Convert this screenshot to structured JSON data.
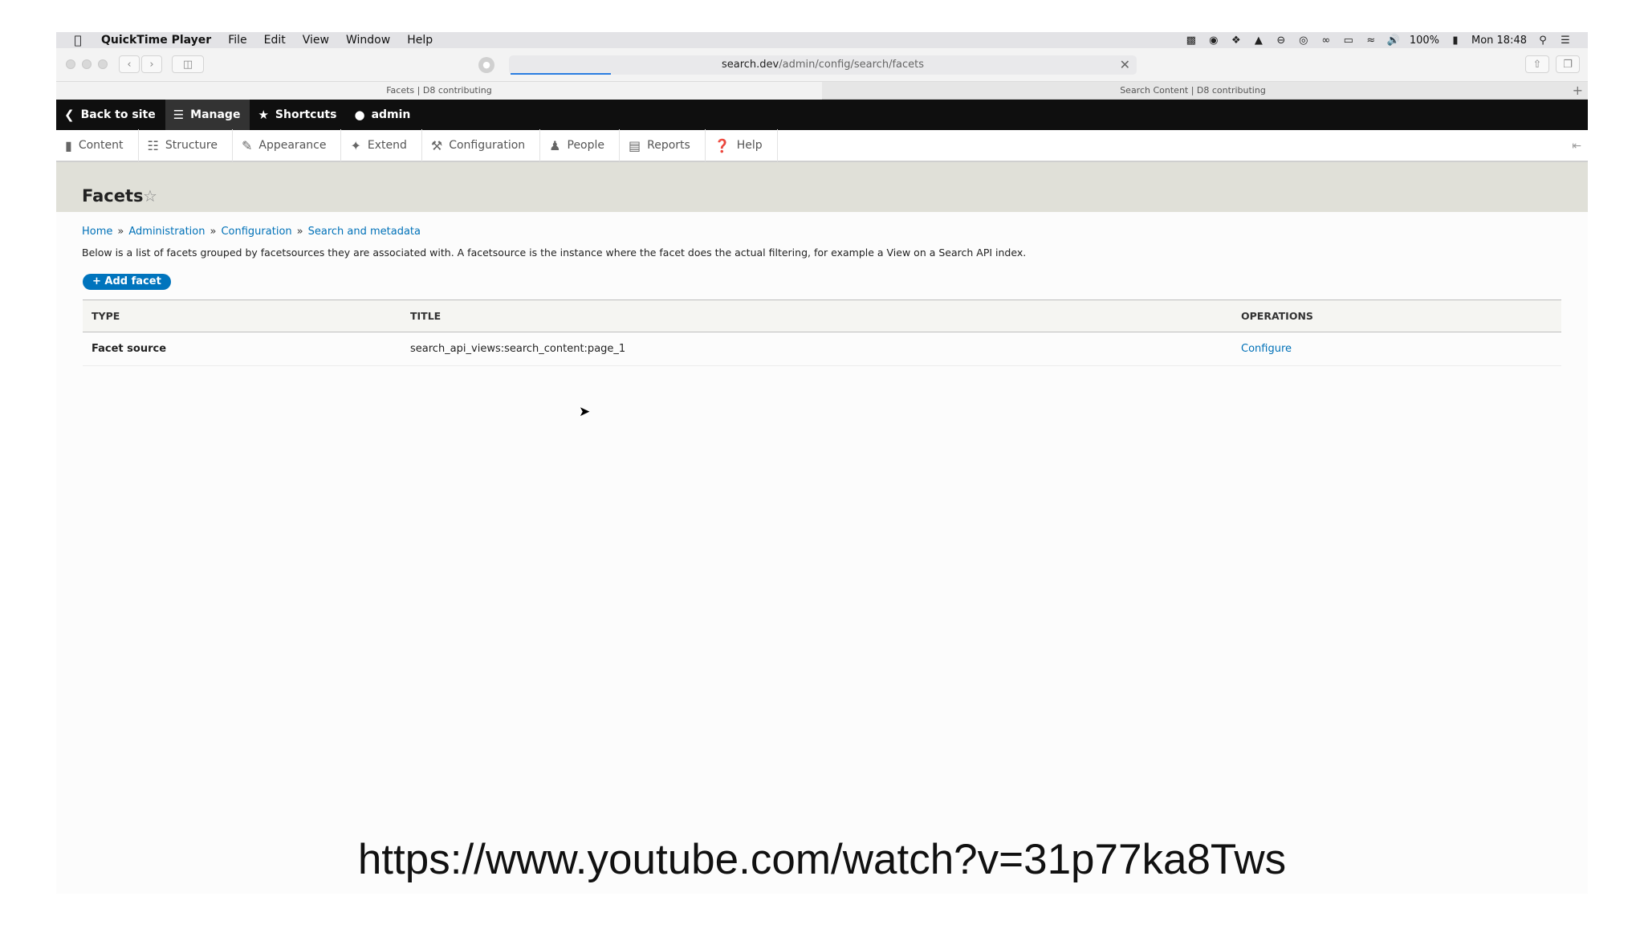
{
  "menubar": {
    "apple_icon": "apple-logo-icon",
    "app_name": "QuickTime Player",
    "menus": [
      "File",
      "Edit",
      "View",
      "Window",
      "Help"
    ],
    "status_icons": [
      "notification-icon",
      "record-icon",
      "dropbox-icon",
      "drive-icon",
      "focus-icon",
      "timer-icon",
      "glasses-icon",
      "airplay-icon",
      "wifi-icon",
      "volume-icon"
    ],
    "battery": "100%",
    "clock": "Mon 18:48"
  },
  "browser": {
    "url_host": "search.dev",
    "url_path": "/admin/config/search/facets",
    "tabs": [
      "Facets | D8 contributing",
      "Search Content | D8 contributing"
    ]
  },
  "drupal_toolbar": {
    "items": [
      {
        "label": "Back to site",
        "icon": "back-icon"
      },
      {
        "label": "Manage",
        "icon": "menu-icon"
      },
      {
        "label": "Shortcuts",
        "icon": "star-icon"
      },
      {
        "label": "admin",
        "icon": "user-icon"
      }
    ]
  },
  "tray": {
    "items": [
      {
        "label": "Content",
        "icon": "document-icon"
      },
      {
        "label": "Structure",
        "icon": "structure-icon"
      },
      {
        "label": "Appearance",
        "icon": "paintbrush-icon"
      },
      {
        "label": "Extend",
        "icon": "puzzle-icon"
      },
      {
        "label": "Configuration",
        "icon": "wrench-icon"
      },
      {
        "label": "People",
        "icon": "people-icon"
      },
      {
        "label": "Reports",
        "icon": "bar-chart-icon"
      },
      {
        "label": "Help",
        "icon": "question-icon"
      }
    ]
  },
  "page": {
    "title": "Facets",
    "breadcrumb": [
      "Home",
      "Administration",
      "Configuration",
      "Search and metadata"
    ],
    "breadcrumb_separator": "»",
    "description": "Below is a list of facets grouped by facetsources they are associated with. A facetsource is the instance where the facet does the actual filtering, for example a View on a Search API index.",
    "add_button": "+ Add facet"
  },
  "table": {
    "headers": [
      "TYPE",
      "TITLE",
      "OPERATIONS"
    ],
    "rows": [
      {
        "type": "Facet source",
        "title": "search_api_views:search_content:page_1",
        "operation": "Configure"
      }
    ]
  },
  "overlay": {
    "url": "https://www.youtube.com/watch?v=31p77ka8Tws"
  }
}
